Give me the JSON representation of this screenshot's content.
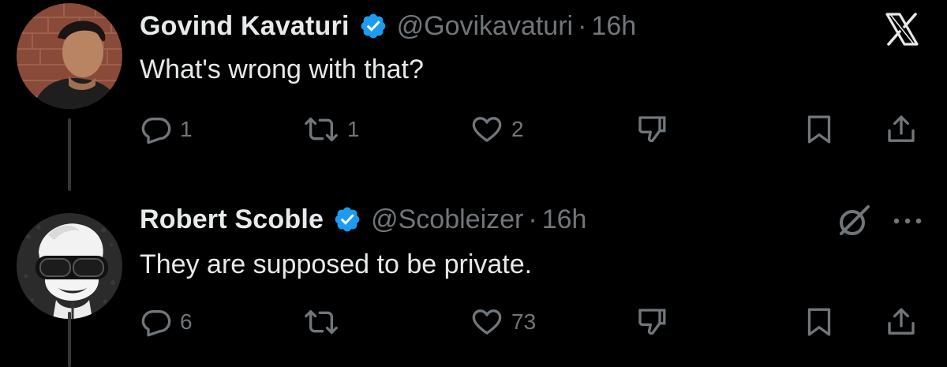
{
  "tweets": [
    {
      "display_name": "Govind Kavaturi",
      "handle": "@Govikavaturi",
      "separator": "·",
      "time": "16h",
      "text": "What's wrong with that?",
      "replies": "1",
      "retweets": "1",
      "likes": "2",
      "icons": [
        "reply-icon",
        "retweet-icon",
        "like-icon",
        "dislike-icon",
        "bookmark-icon",
        "share-icon"
      ]
    },
    {
      "display_name": "Robert Scoble",
      "handle": "@Scobleizer",
      "separator": "·",
      "time": "16h",
      "text": "They are supposed to be private.",
      "replies": "6",
      "retweets": "",
      "likes": "73",
      "icons": [
        "reply-icon",
        "retweet-icon",
        "like-icon",
        "dislike-icon",
        "bookmark-icon",
        "share-icon"
      ]
    }
  ],
  "header_icons": [
    "x-logo-icon",
    "grok-icon",
    "more-icon"
  ],
  "colors": {
    "background": "#000000",
    "primary_text": "#e7e9ea",
    "secondary_text": "#71767b",
    "verified_badge": "#1d9bf0",
    "thread_line": "#333639"
  }
}
